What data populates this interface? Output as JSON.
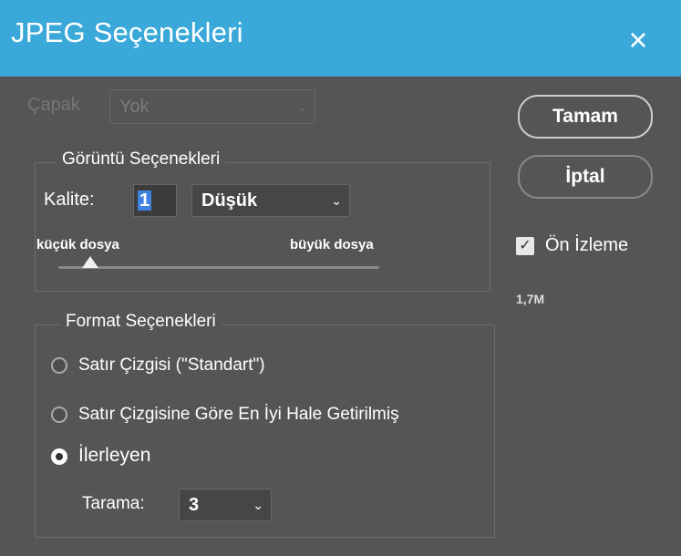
{
  "window": {
    "title": "JPEG Seçenekleri",
    "close_icon": "×"
  },
  "matte": {
    "label": "Çapak",
    "value": "Yok"
  },
  "image_options": {
    "group_title": "Görüntü Seçenekleri",
    "quality_label": "Kalite:",
    "quality_value": "1",
    "quality_preset": "Düşük",
    "small_file_label": "küçük dosya",
    "large_file_label": "büyük dosya",
    "quality_level_fraction": 0.1
  },
  "buttons": {
    "ok": "Tamam",
    "cancel": "İptal"
  },
  "preview": {
    "label": "Ön İzleme",
    "checked": true,
    "size": "1,7M"
  },
  "format_options": {
    "group_title": "Format Seçenekleri",
    "options": [
      {
        "label": "Satır Çizgisi (\"Standart\")",
        "selected": false
      },
      {
        "label": "Satır Çizgisine Göre En İyi Hale Getirilmiş",
        "selected": false
      },
      {
        "label": "İlerleyen",
        "selected": true
      }
    ],
    "scans_label": "Tarama:",
    "scans_value": "3"
  }
}
